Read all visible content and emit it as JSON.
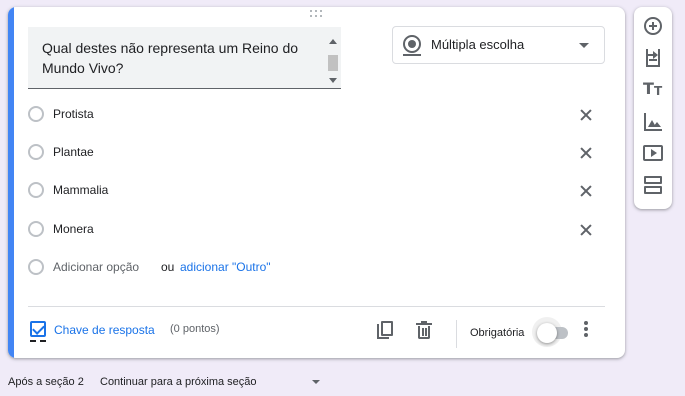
{
  "question": {
    "text": "Qual destes não representa um Reino do Mundo Vivo?"
  },
  "question_type": {
    "selected": "Múltipla escolha",
    "icon": "radio-button-icon"
  },
  "options": [
    {
      "label": "Protista"
    },
    {
      "label": "Plantae"
    },
    {
      "label": "Mammalia"
    },
    {
      "label": "Monera"
    }
  ],
  "add_option": {
    "label": "Adicionar opção",
    "or": "ou",
    "other": "adicionar \"Outro\""
  },
  "footer": {
    "answer_key": "Chave de resposta",
    "points": "(0 pontos)",
    "required": "Obrigatória",
    "required_on": false
  },
  "toolbar": {
    "icons": [
      "add-question-icon",
      "import-questions-icon",
      "add-title-icon",
      "add-image-icon",
      "add-video-icon",
      "add-section-icon"
    ]
  },
  "section_nav": {
    "after_label": "Após a seção 2",
    "selected": "Continuar para a próxima seção"
  },
  "colors": {
    "accent": "#4285f4",
    "link": "#1a73e8",
    "background": "#f0ebf8"
  }
}
